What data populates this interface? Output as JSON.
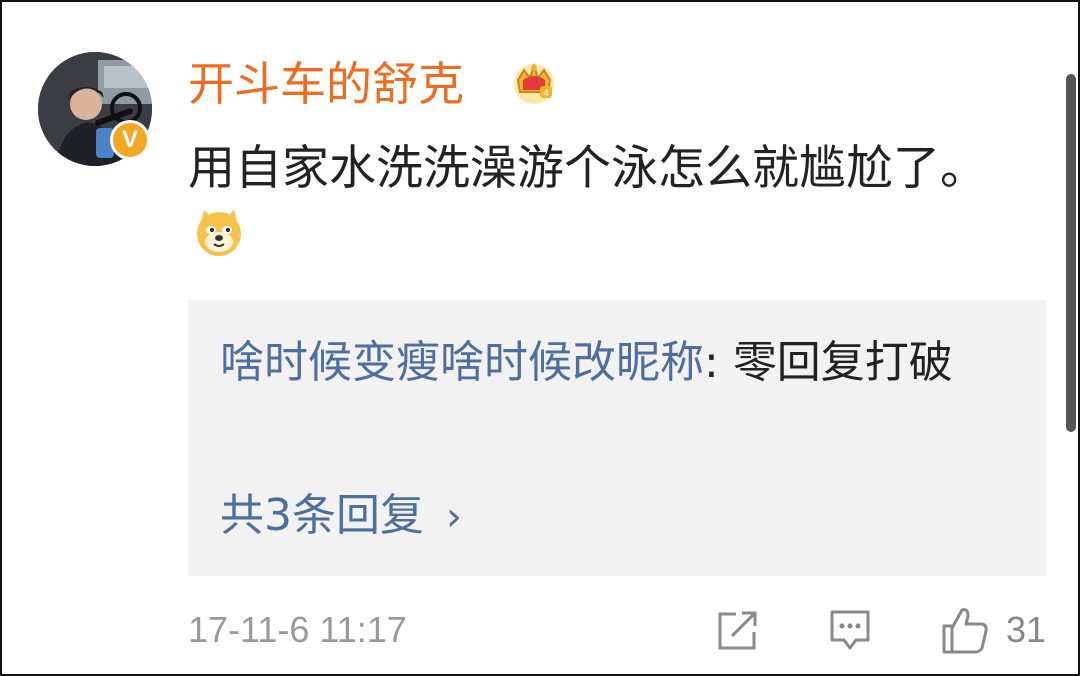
{
  "comment": {
    "username": "开斗车的舒克",
    "text": "用自家水洗洗澡游个泳怎么就尴尬了。",
    "verified_badge": "V",
    "badge_icon": "crown-vip-icon",
    "emoji": "doge-emoji",
    "colors": {
      "username": "#f26b1d",
      "link": "#4e6ea0",
      "text": "#222222",
      "meta": "#999999",
      "reply_bg": "#f2f2f2",
      "badge": "#f6a623"
    }
  },
  "reply": {
    "user": "啥时候变瘦啥时候改昵称",
    "separator": ": ",
    "text": "零回复打破",
    "count_label": "共3条回复",
    "chevron": "›"
  },
  "footer": {
    "timestamp": "17-11-6 11:17",
    "actions": [
      "share-icon",
      "comment-icon",
      "like-icon"
    ],
    "like_count": "31"
  }
}
